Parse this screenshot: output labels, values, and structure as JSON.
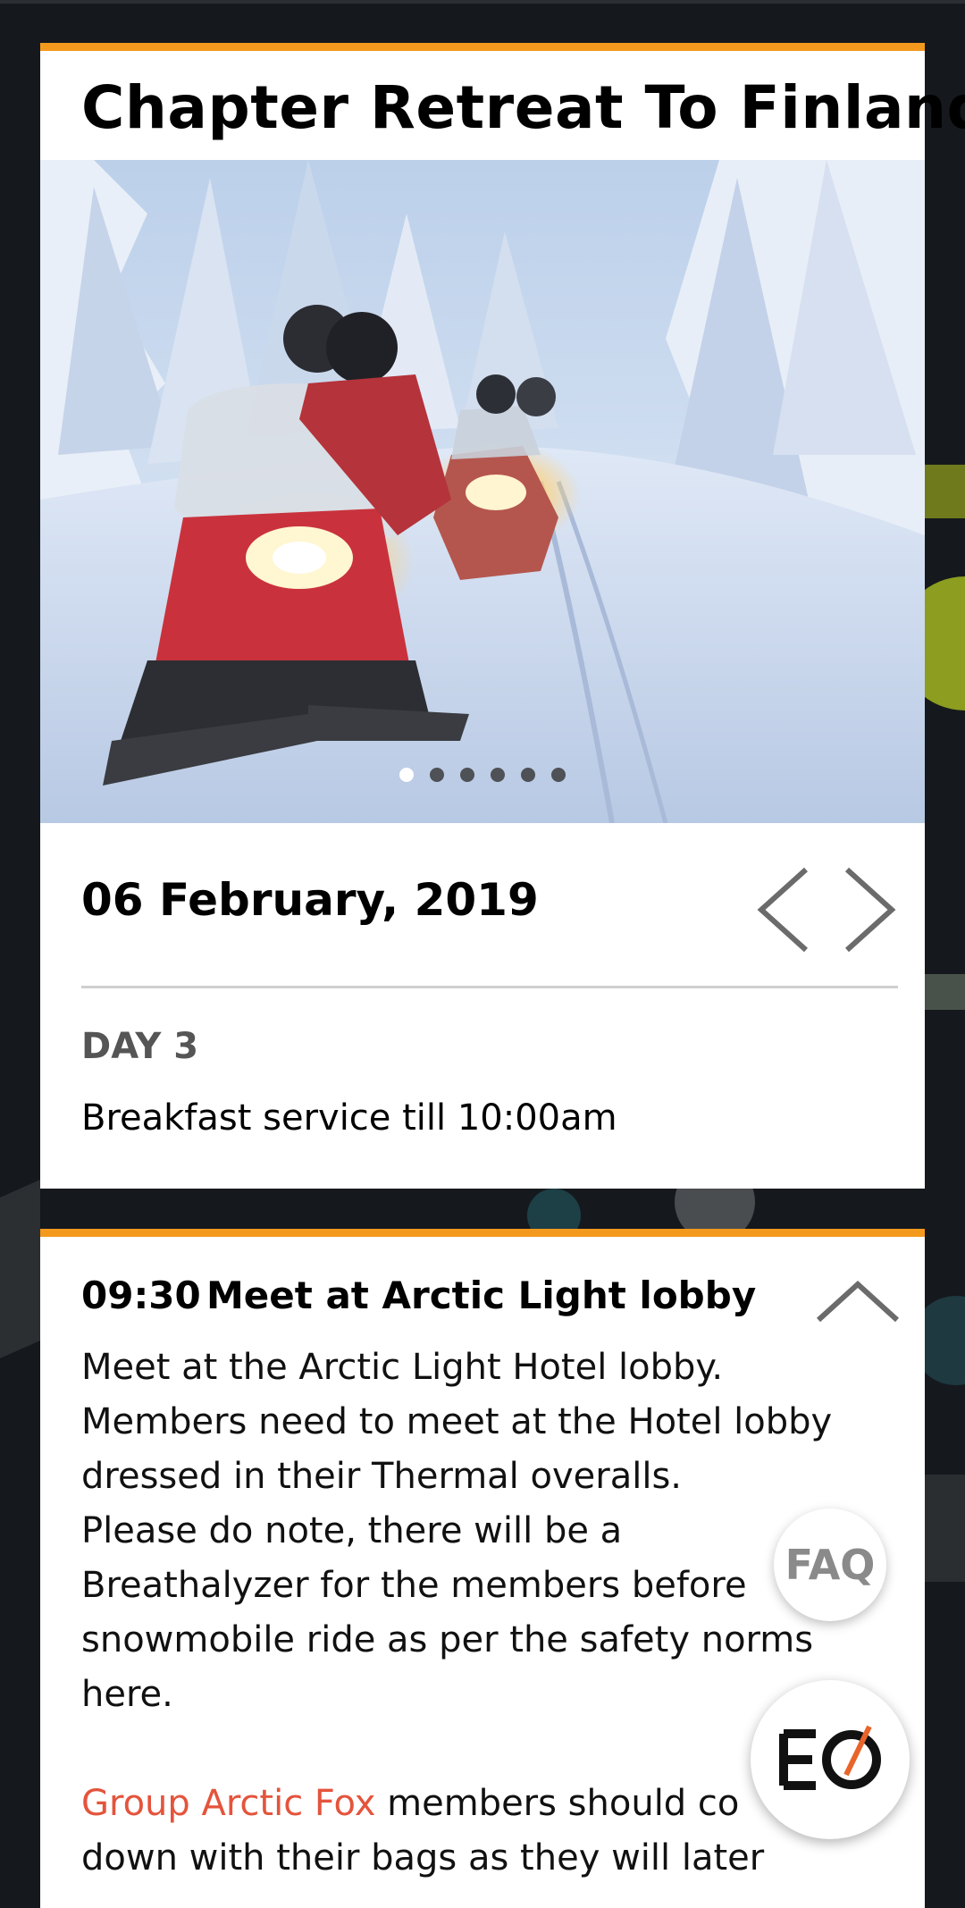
{
  "event": {
    "title": "Chapter Retreat To Finland"
  },
  "carousel": {
    "slide_count": 6,
    "active_index": 0
  },
  "schedule": {
    "date": "06 February, 2019",
    "day_label": "DAY 3",
    "day_note": "Breakfast service till 10:00am"
  },
  "item": {
    "time": "09:30",
    "title": "Meet at Arctic Light lobby",
    "desc_lines": [
      "Meet at the Arctic Light Hotel lobby.",
      "Members need to meet at the Hotel lobby",
      "dressed in their Thermal overalls.",
      "Please do note, there will be a",
      "Breathalyzer for the members before",
      "snowmobile ride as per the safety norms",
      "here."
    ],
    "group_name": "Group Arctic Fox",
    "group_text_1": " members should co",
    "group_text_2": "down with their bags as they will later"
  },
  "floating": {
    "faq_label": "FAQ",
    "logo_text": "EO"
  },
  "colors": {
    "accent": "#f39a1e",
    "link": "#e4543c",
    "background": "#15191d"
  }
}
